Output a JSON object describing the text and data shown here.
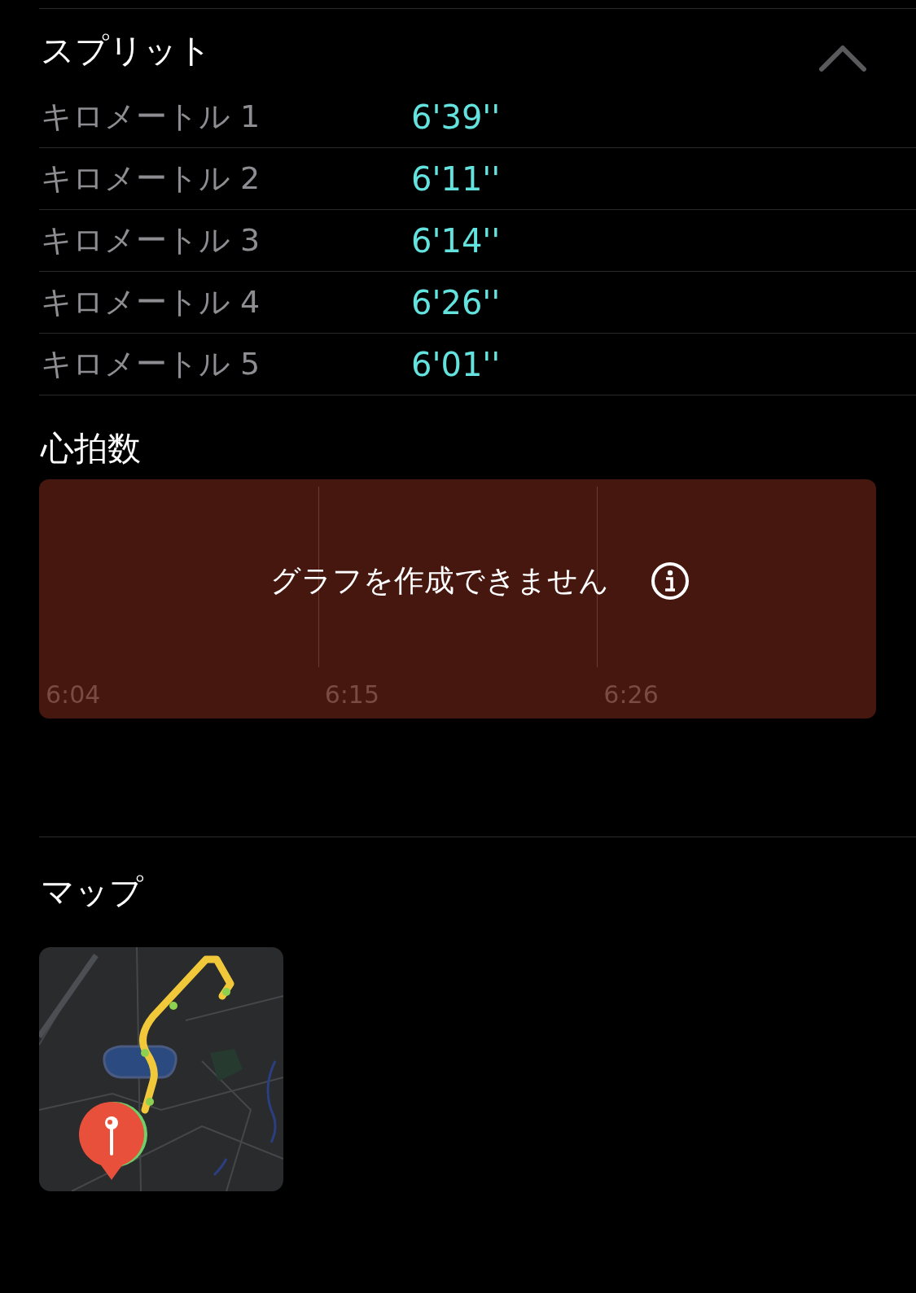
{
  "splits": {
    "title": "スプリット",
    "expanded": true,
    "rows": [
      {
        "label": "キロメートル 1",
        "pace": "6'39''"
      },
      {
        "label": "キロメートル 2",
        "pace": "6'11''"
      },
      {
        "label": "キロメートル 3",
        "pace": "6'14''"
      },
      {
        "label": "キロメートル 4",
        "pace": "6'26''"
      },
      {
        "label": "キロメートル 5",
        "pace": "6'01''"
      }
    ]
  },
  "heart_rate": {
    "title": "心拍数",
    "message": "グラフを作成できません",
    "time_labels": [
      "6:04",
      "6:15",
      "6:26"
    ]
  },
  "map": {
    "title": "マップ",
    "kind": "picture"
  }
}
